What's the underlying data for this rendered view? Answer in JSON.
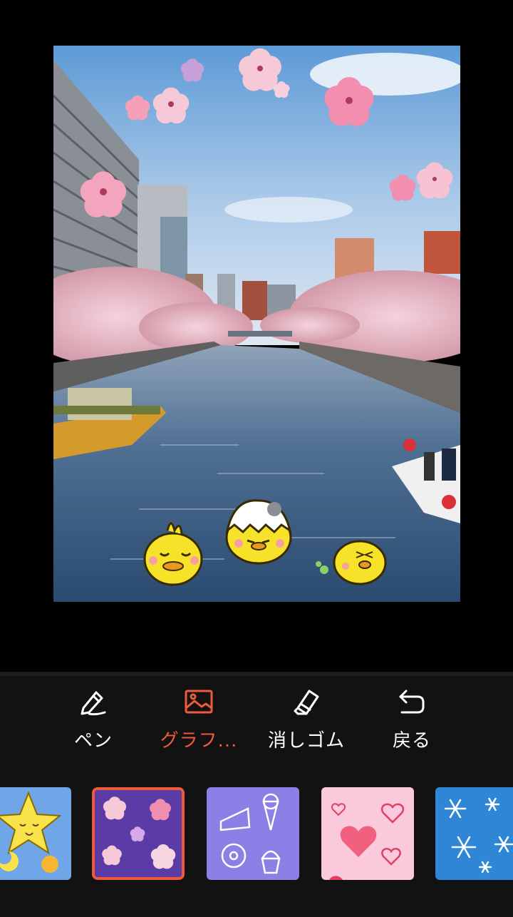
{
  "colors": {
    "accent": "#ef5b3a",
    "toolbar_bg": "#121212",
    "text": "#ffffff"
  },
  "toolbar": {
    "tools": [
      {
        "id": "pen",
        "label": "ペン",
        "icon": "pen-icon",
        "active": false
      },
      {
        "id": "graphic",
        "label": "グラフ...",
        "icon": "image-icon",
        "active": true
      },
      {
        "id": "eraser",
        "label": "消しゴム",
        "icon": "eraser-icon",
        "active": false
      },
      {
        "id": "back",
        "label": "戻る",
        "icon": "undo-icon",
        "active": false
      }
    ]
  },
  "stickers": [
    {
      "name": "star-moon-sticker",
      "selected": false
    },
    {
      "name": "sakura-frame-sticker",
      "selected": true
    },
    {
      "name": "sweets-sticker",
      "selected": false
    },
    {
      "name": "hearts-sticker",
      "selected": false
    },
    {
      "name": "snowflake-sticker",
      "selected": false
    }
  ]
}
